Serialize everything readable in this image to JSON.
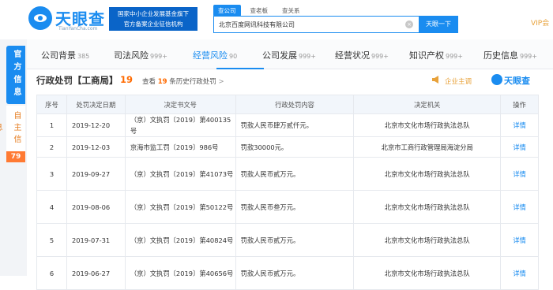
{
  "header": {
    "logo_text": "天眼查",
    "logo_sub": "TianYanCha.com",
    "slogan_line1": "国家中小企业发展基金旗下",
    "slogan_line2": "官方备案企业征信机构",
    "search_tabs": [
      "查公司",
      "查老板",
      "查关系"
    ],
    "search_value": "北京百度网讯科技有限公司",
    "search_button": "天眼一下",
    "vip": "VIP会"
  },
  "sidebar": {
    "official": "官方信息",
    "self": "自主信息",
    "badge": "79"
  },
  "nav": [
    {
      "label": "公司背景",
      "count": "385"
    },
    {
      "label": "司法风险",
      "count": "999+"
    },
    {
      "label": "经营风险",
      "count": "90"
    },
    {
      "label": "公司发展",
      "count": "999+"
    },
    {
      "label": "经营状况",
      "count": "999+"
    },
    {
      "label": "知识产权",
      "count": "999+"
    },
    {
      "label": "历史信息",
      "count": "999+"
    }
  ],
  "section": {
    "title": "行政处罚【工商局】",
    "count": "19",
    "history_prefix": "查看",
    "history_num": "19",
    "history_suffix": "条历史行政处罚",
    "history_chevron": ">",
    "highlight": "企业主调",
    "brand": "天眼查"
  },
  "table": {
    "headers": [
      "序号",
      "处罚决定日期",
      "决定书文号",
      "行政处罚内容",
      "决定机关",
      "操作"
    ],
    "rows": [
      {
        "idx": "1",
        "date": "2019-12-20",
        "doc": "（京）文执罚〔2019〕第400135号",
        "content": "罚款人民币肆万贰仟元。",
        "authority": "北京市文化市场行政执法总队",
        "op": "详情"
      },
      {
        "idx": "2",
        "date": "2019-12-03",
        "doc": "京海市监工罚〔2019〕986号",
        "content": "罚款30000元。",
        "authority": "北京市工商行政管理局海淀分局",
        "op": "详情"
      },
      {
        "idx": "3",
        "date": "2019-09-27",
        "doc": "（京）文执罚〔2019〕第41073号",
        "content": "罚款人民币贰万元。",
        "authority": "北京市文化市场行政执法总队",
        "op": "详情"
      },
      {
        "idx": "4",
        "date": "2019-08-06",
        "doc": "（京）文执罚〔2019〕第50122号",
        "content": "罚款人民币叁万元。",
        "authority": "北京市文化市场行政执法总队",
        "op": "详情"
      },
      {
        "idx": "5",
        "date": "2019-07-31",
        "doc": "（京）文执罚〔2019〕第40824号",
        "content": "罚款人民币贰万元。",
        "authority": "北京市文化市场行政执法总队",
        "op": "详情"
      },
      {
        "idx": "6",
        "date": "2019-06-27",
        "doc": "（京）文执罚〔2019〕第40656号",
        "content": "罚款人民币贰万元。",
        "authority": "北京市文化市场行政执法总队",
        "op": "详情"
      }
    ]
  }
}
